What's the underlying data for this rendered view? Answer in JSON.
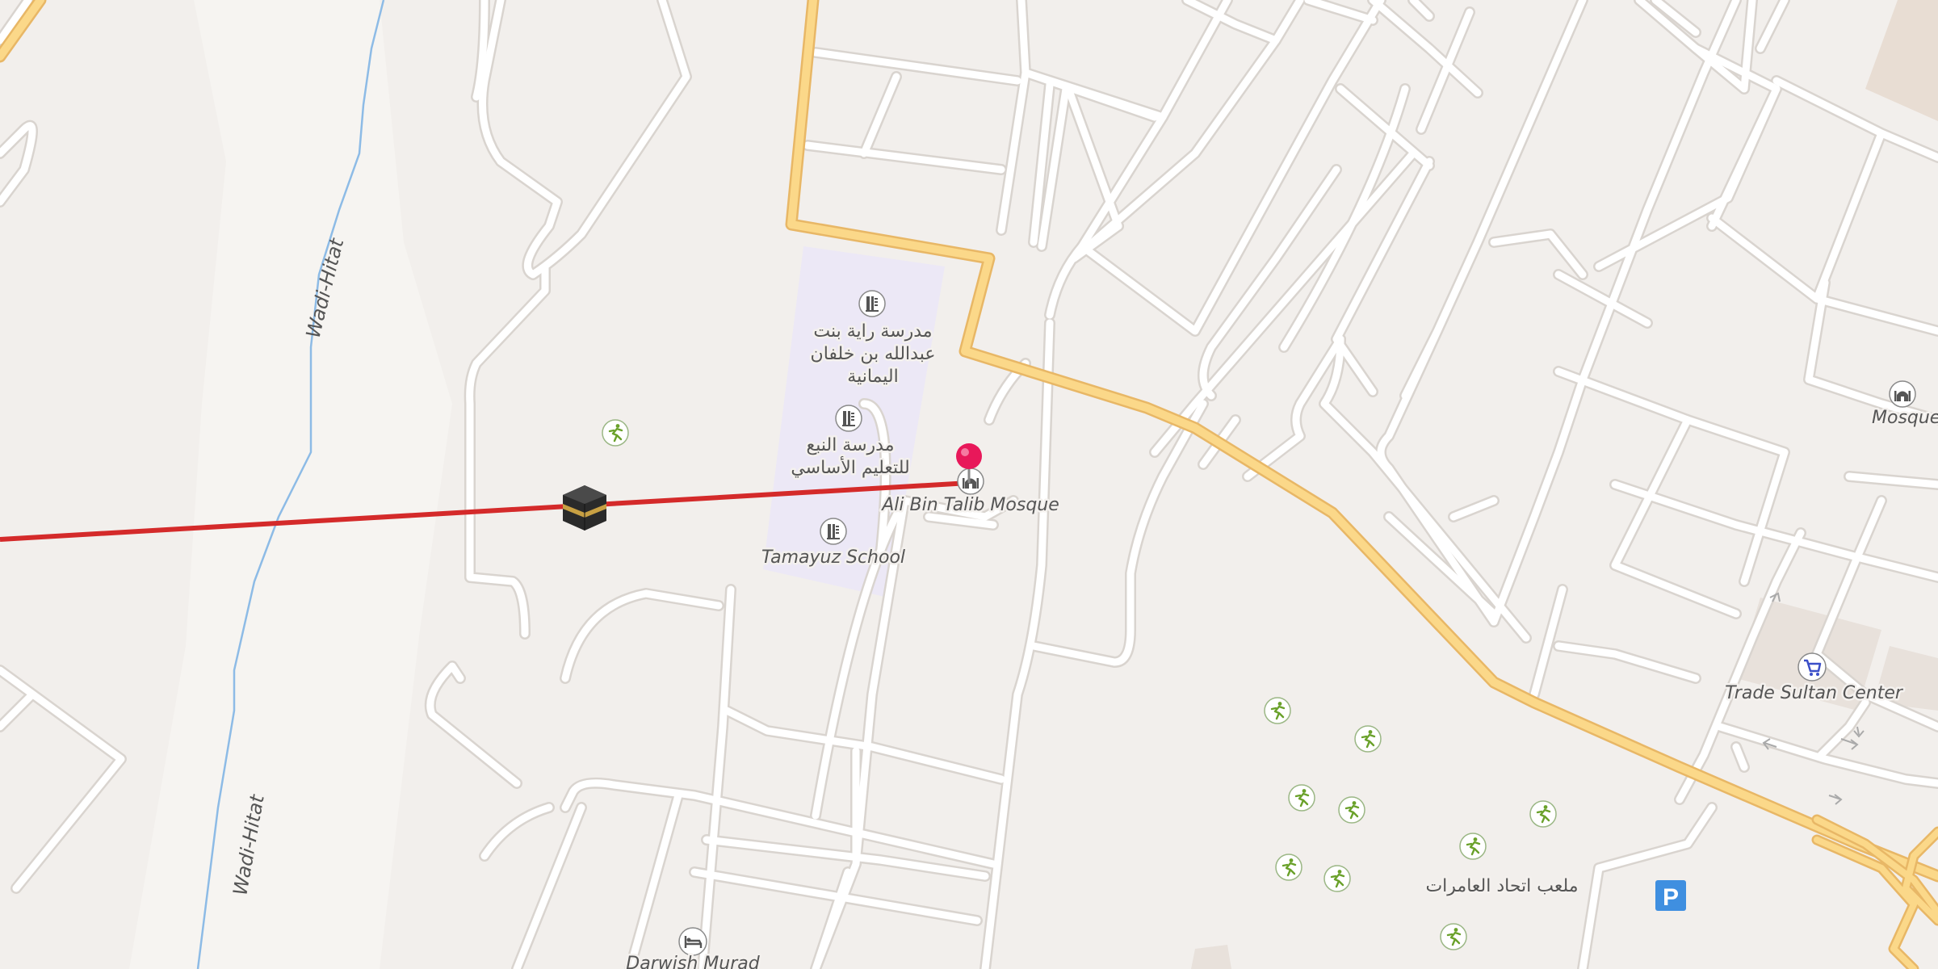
{
  "map": {
    "labels": {
      "wadi_upper": "Wadi-Hitat",
      "wadi_lower": "Wadi-Hitat",
      "school_raya": [
        "مدرسة راية بنت",
        "عبدالله بن خلفان",
        "اليمانية"
      ],
      "school_nabaa": [
        "مدرسة النبع",
        "للتعليم الأساسي"
      ],
      "tamayuz_school": "Tamayuz School",
      "ali_bin_talib_mosque": "Ali Bin Talib Mosque",
      "mosque_right": "Mosque",
      "trade_sultan_center": "Trade Sultan Center",
      "playground_arabic": "ملعب اتحاد العامرات",
      "darwish_murad": "Darwish Murad",
      "parking_letter": "P"
    },
    "colors": {
      "background": "#f2efec",
      "road_casing": "#dcd7d2",
      "road_white": "#ffffff",
      "primary_road": "#fbd889",
      "primary_road_casing": "#e8b766",
      "school_area": "#ece8f6",
      "wadi_river": "#8dbbe6",
      "qibla_line": "#d42a2a",
      "pin": "#e8185a",
      "parking": "#3f8fe0",
      "poi_icon": "#6e6e6e",
      "playground_icon": "#6aa12a",
      "shop_icon": "#3b4fc8"
    },
    "icons": {
      "kaaba": "kaaba-icon",
      "pin": "location-pin-icon",
      "school": "school-icon",
      "mosque": "mosque-icon",
      "playground": "playground-icon",
      "shop": "shopping-cart-icon",
      "hotel": "bed-icon",
      "parking": "parking-icon"
    }
  }
}
